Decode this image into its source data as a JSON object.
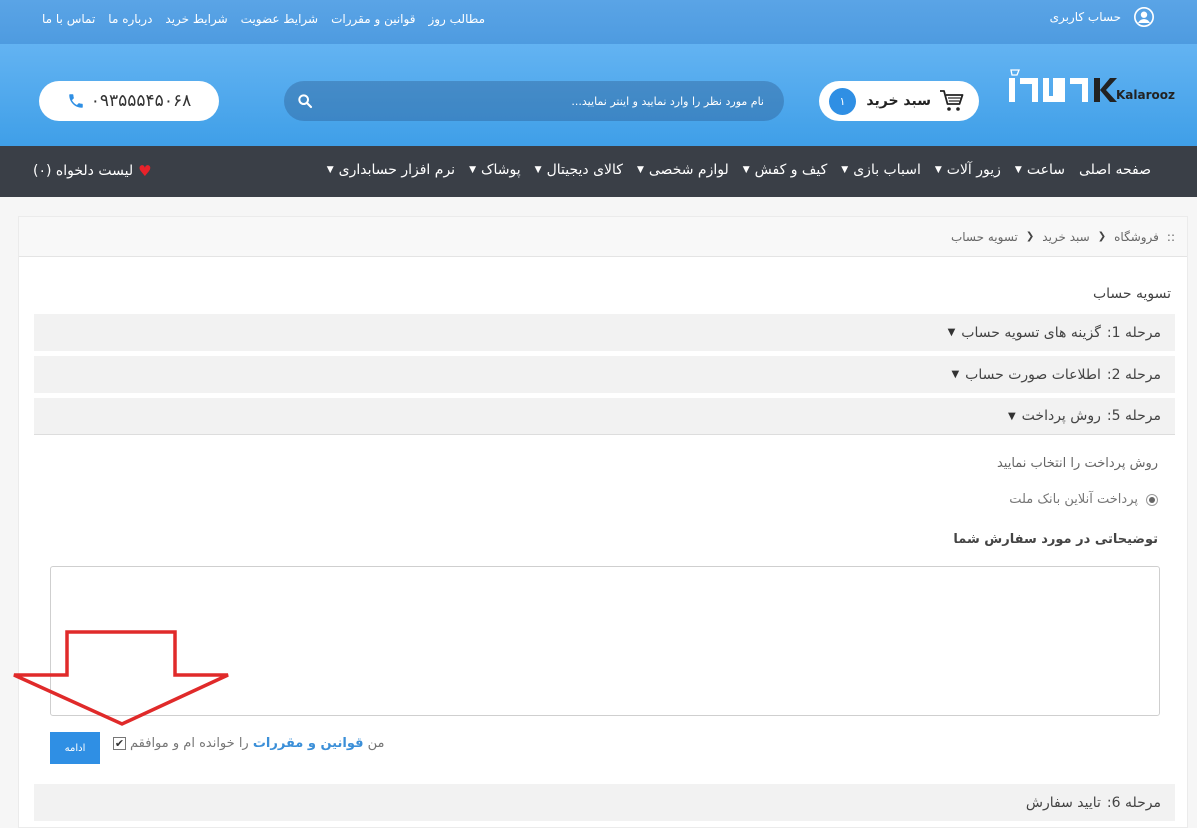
{
  "topbar": {
    "links": [
      "مطالب روز",
      "قوانین و مقررات",
      "شرایط عضویت",
      "شرایط خرید",
      "درباره ما",
      "تماس با ما"
    ],
    "account_label": "حساب کاربری"
  },
  "header": {
    "phone": "۰۹۳۵۵۵۴۵۰۶۸",
    "search_placeholder": "نام مورد نظر را وارد نمایید و اینتر نمایید...",
    "cart_label": "سبد خرید",
    "cart_count": "۱",
    "logo_text": "Kalarooz"
  },
  "nav": {
    "items": [
      {
        "label": "صفحه اصلی",
        "caret": false
      },
      {
        "label": "ساعت",
        "caret": true
      },
      {
        "label": "زیور آلات",
        "caret": true
      },
      {
        "label": "اسباب بازی",
        "caret": true
      },
      {
        "label": "کیف و کفش",
        "caret": true
      },
      {
        "label": "لوازم شخصی",
        "caret": true
      },
      {
        "label": "کالای دیجیتال",
        "caret": true
      },
      {
        "label": "پوشاک",
        "caret": true
      },
      {
        "label": "نرم افزار حسابداری",
        "caret": true
      }
    ],
    "wishlist": "لیست دلخواه (۰)"
  },
  "breadcrumb": {
    "marker": "::",
    "items": [
      "فروشگاه",
      "سبد خرید",
      "تسویه حساب"
    ]
  },
  "page_title": "تسویه حساب",
  "steps": {
    "step1": {
      "num": "مرحله 1:",
      "title": "گزینه های تسویه حساب"
    },
    "step2": {
      "num": "مرحله 2:",
      "title": "اطلاعات صورت حساب"
    },
    "step5": {
      "num": "مرحله 5:",
      "title": "روش پرداخت"
    },
    "step6": {
      "num": "مرحله 6:",
      "title": "تایید سفارش"
    }
  },
  "payment": {
    "choose_text": "روش پرداخت را انتخاب نمایید",
    "option_label": "پرداخت آنلاین بانک ملت",
    "selected": true
  },
  "comment_label": "توضیحاتی در مورد سفارش شما",
  "agree": {
    "prefix": "من",
    "terms_link": "قوانین و مقررات",
    "suffix": "را خوانده ام و موافقم",
    "checked": true
  },
  "continue_label": "ادامه",
  "colors": {
    "accent": "#2f8fe4",
    "nav_bg": "#3a3f47",
    "arrow": "#e02a2a",
    "heart": "#e8222a"
  }
}
